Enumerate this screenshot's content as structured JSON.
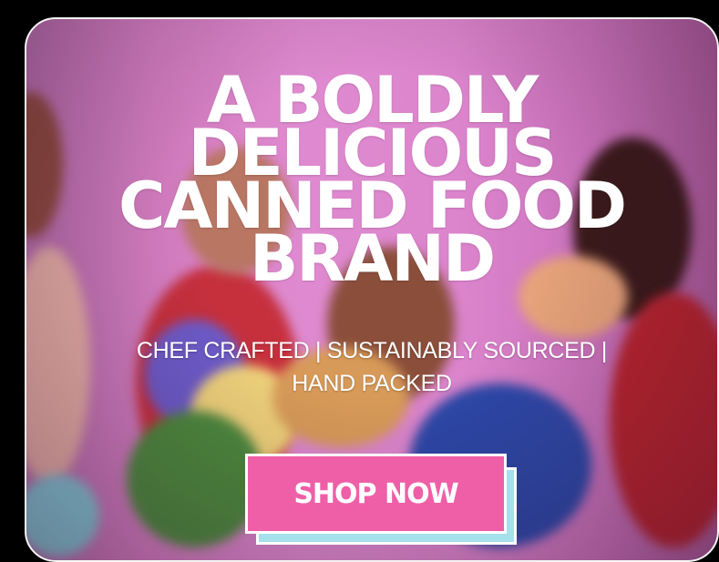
{
  "hero": {
    "headline_lines": [
      "A BOLDLY",
      "DELICIOUS",
      "CANNED FOOD",
      "BRAND"
    ],
    "subline_lines": [
      "CHEF CRAFTED | SUSTAINABLY SOURCED |",
      "HAND PACKED"
    ]
  },
  "cta": {
    "label": "SHOP NOW"
  },
  "colors": {
    "background": "#000000",
    "hero_pink": "#df8ad0",
    "button_pink": "#ef5fa7",
    "button_shadow_blue": "#a5e0eb",
    "text": "#ffffff"
  }
}
